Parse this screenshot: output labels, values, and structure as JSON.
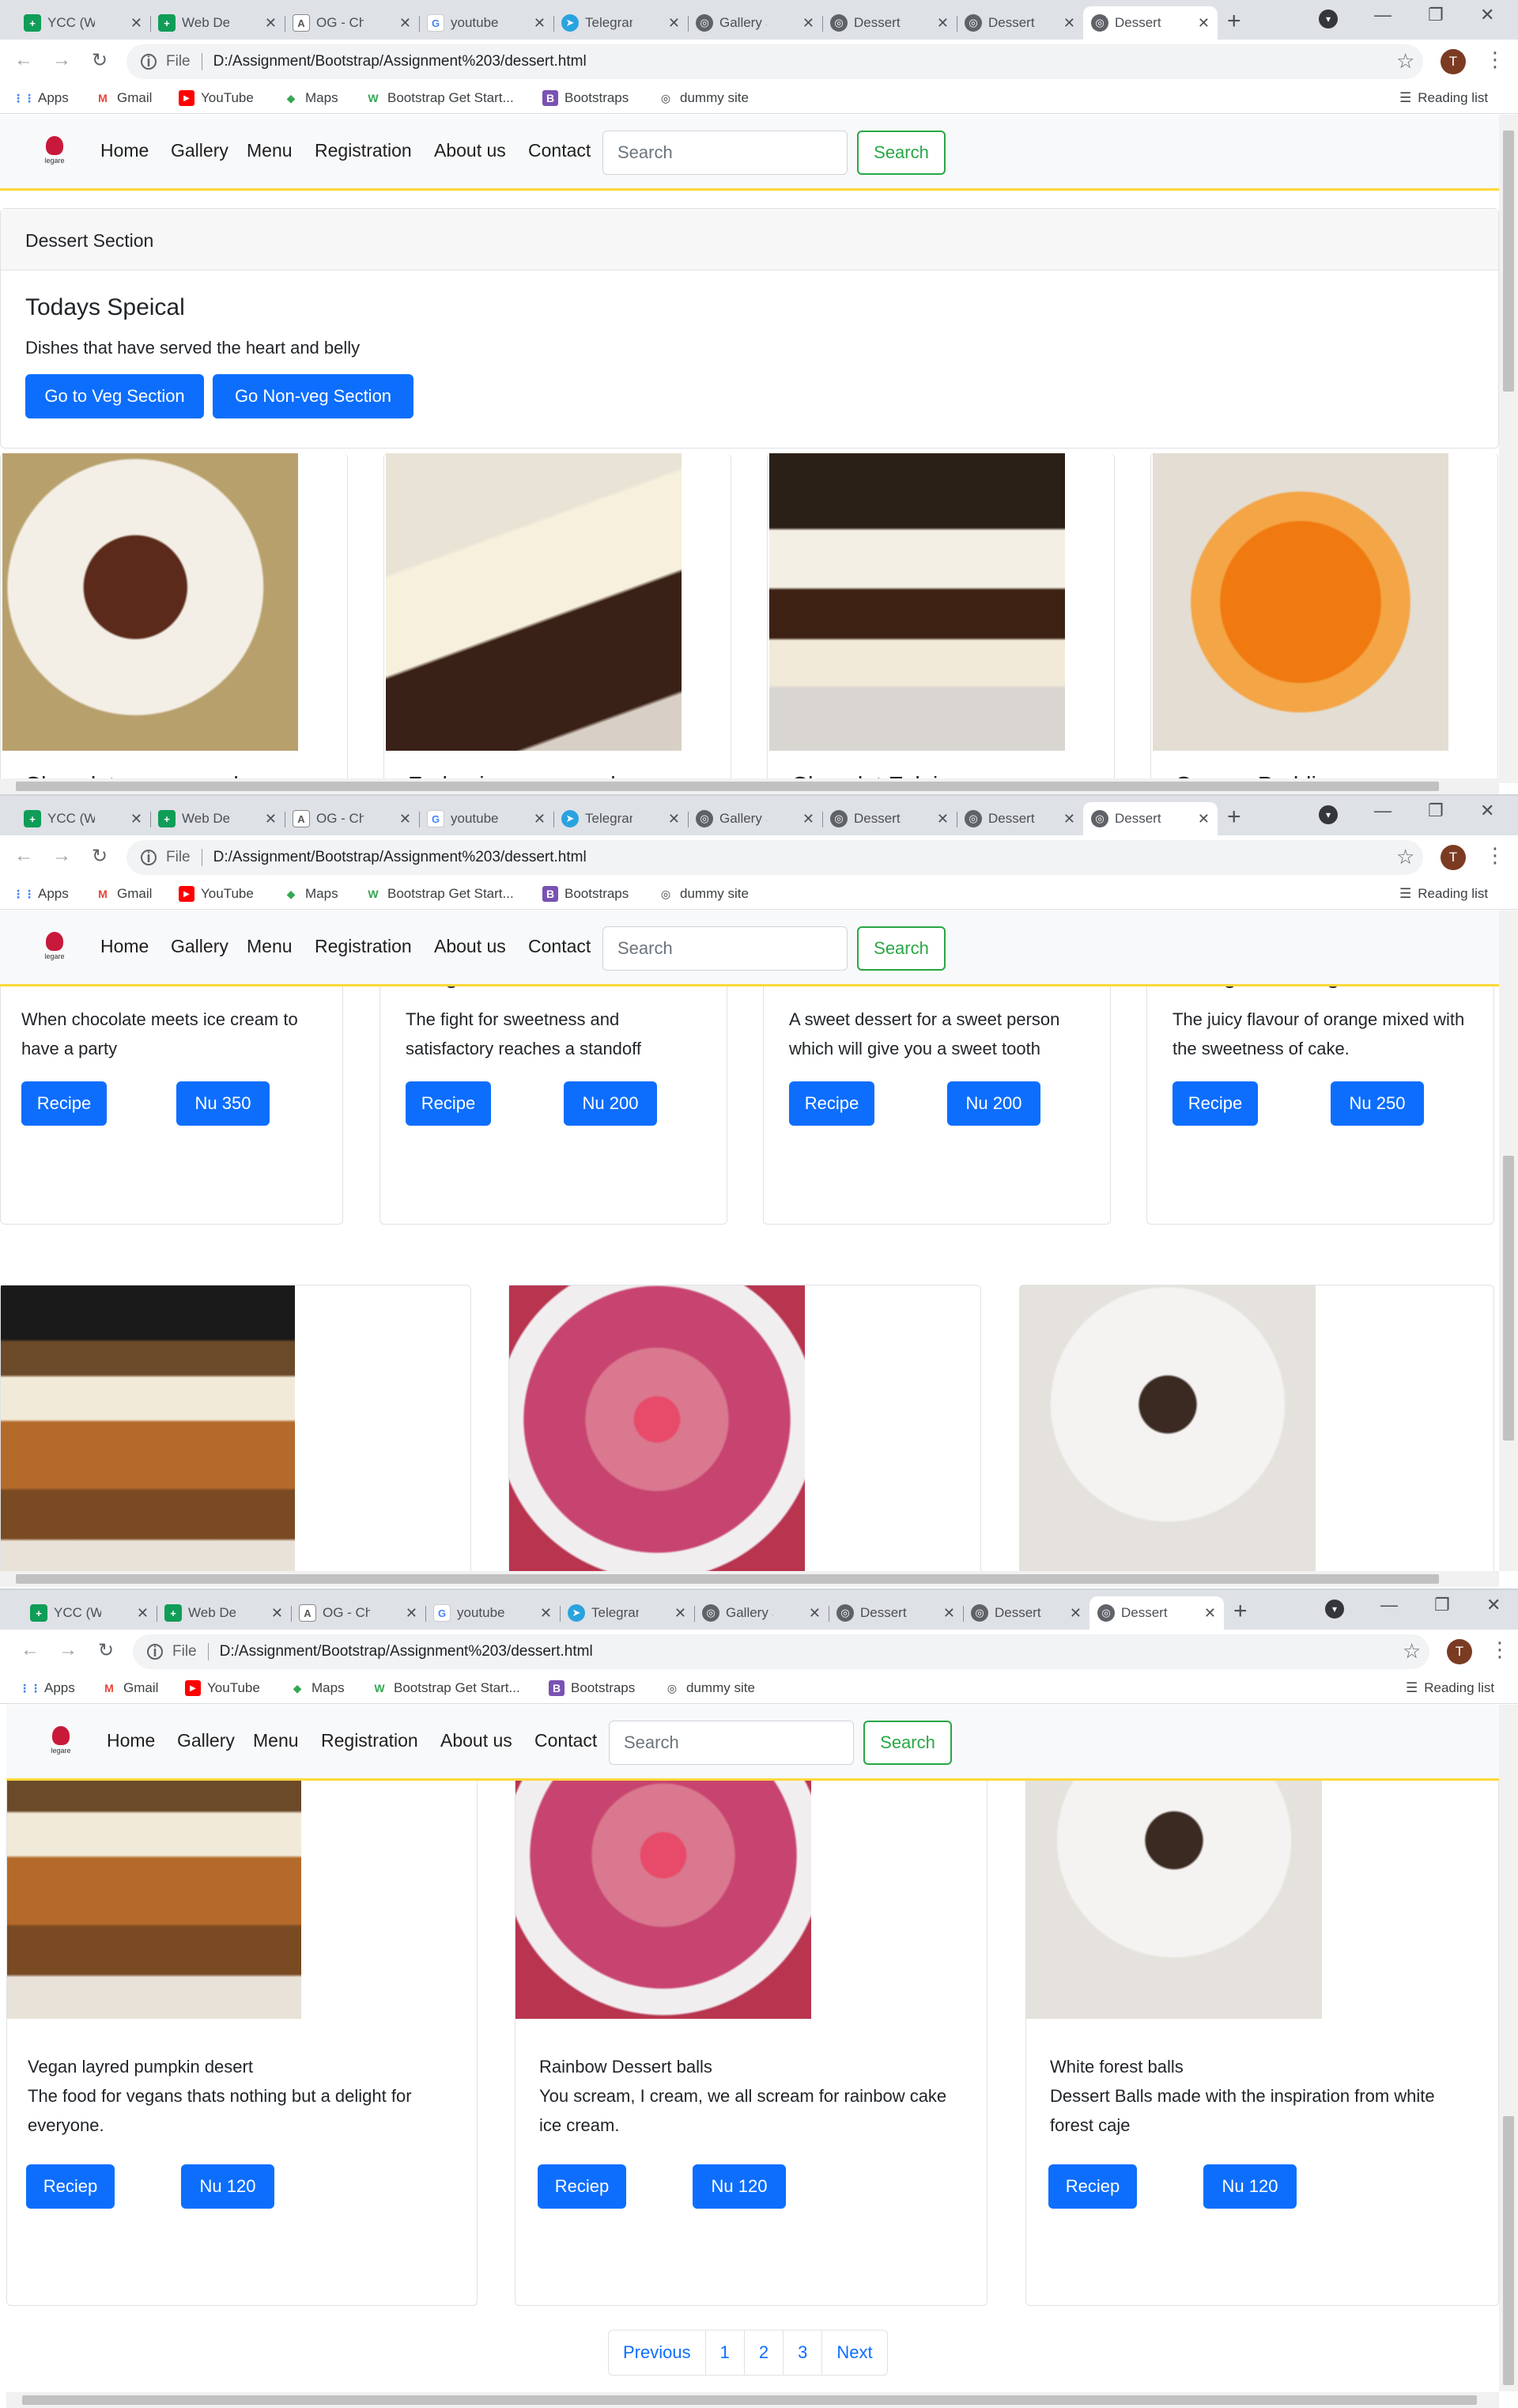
{
  "browser": {
    "tabs": [
      "YCC (Wel",
      "Web Dev",
      "OG - Cha",
      "youtube",
      "Telegram",
      "Gallery S",
      "Dessert S",
      "Dessert S",
      "Dessert S"
    ],
    "new_tab": "+",
    "url_prefix": "File",
    "url": "D:/Assignment/Bootstrap/Assignment%203/dessert.html",
    "avatar": "T",
    "bookmarks": [
      "Apps",
      "Gmail",
      "YouTube",
      "Maps",
      "Bootstrap Get Start...",
      "Bootstraps",
      "dummy site"
    ],
    "reading_list": "Reading list"
  },
  "navbar": {
    "logo_text": "legare",
    "links": [
      "Home",
      "Gallery",
      "Menu",
      "Registration",
      "About us",
      "Contact"
    ],
    "search_placeholder": "Search",
    "search_button": "Search"
  },
  "jumbotron": {
    "header": "Dessert Section",
    "title": "Todays Speical",
    "text": "Dishes that have served the heart and belly",
    "btn_veg": "Go to Veg Section",
    "btn_nonveg": "Go Non-veg Section"
  },
  "cards_row1": [
    {
      "title": "Chocolate moose cake",
      "text": "When chocolate meets ice cream to have a party",
      "recipe": "Recipe",
      "price": "Nu 350"
    },
    {
      "title": "Fudge ice-cream cake",
      "text": "The fight for sweetness and satisfactory reaches a standoff",
      "recipe": "Recipe",
      "price": "Nu 200"
    },
    {
      "title": "Chocolat Eclairs",
      "text": "A sweet dessert for a sweet person which will give you a sweet tooth",
      "recipe": "Recipe",
      "price": "Nu 200"
    },
    {
      "title": "Orange Pudding",
      "text": "The juicy flavour of orange mixed with the sweetness of cake.",
      "recipe": "Recipe",
      "price": "Nu 250"
    }
  ],
  "cards_row2": [
    {
      "title": "Vegan layred pumpkin desert",
      "text": "The food for vegans thats nothing but a delight for everyone.",
      "recipe": "Reciep",
      "price": "Nu 120"
    },
    {
      "title": "Rainbow Dessert balls",
      "text": "You scream, I cream, we all scream for rainbow cake ice cream.",
      "recipe": "Reciep",
      "price": "Nu 120"
    },
    {
      "title": "White forest balls",
      "text": "Dessert Balls made with the inspiration from white forest caje",
      "recipe": "Reciep",
      "price": "Nu 120"
    }
  ],
  "pagination": [
    "Previous",
    "1",
    "2",
    "3",
    "Next"
  ],
  "colors": {
    "primary": "#0d6efd",
    "success": "#28a745",
    "navbar_bg": "#f8f9fa",
    "navbar_border": "#ffd83a"
  }
}
